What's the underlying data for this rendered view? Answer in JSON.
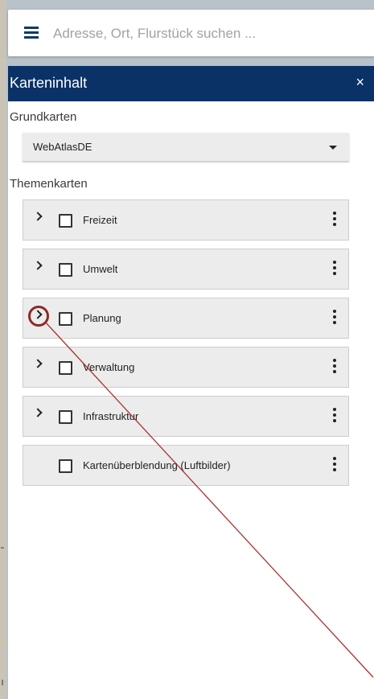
{
  "search": {
    "placeholder": "Adresse, Ort, Flurstück suchen ..."
  },
  "panel": {
    "title": "Karteninhalt",
    "close_symbol": "×",
    "basemaps_label": "Grundkarten",
    "basemap_selected": "WebAtlasDE",
    "themes_label": "Themenkarten",
    "layers": [
      {
        "label": "Freizeit",
        "expandable": true
      },
      {
        "label": "Umwelt",
        "expandable": true
      },
      {
        "label": "Planung",
        "expandable": true
      },
      {
        "label": "Verwaltung",
        "expandable": true
      },
      {
        "label": "Infrastruktur",
        "expandable": true
      },
      {
        "label": "Kartenüberblendung (Luftbilder)",
        "expandable": false
      }
    ]
  },
  "icons": [
    "menu-icon",
    "close-icon",
    "dropdown-caret-icon",
    "chevron-right-icon",
    "checkbox-icon",
    "more-vert-icon"
  ],
  "colors": {
    "header": "#0a3266",
    "annotation": "#8b2a2a"
  }
}
